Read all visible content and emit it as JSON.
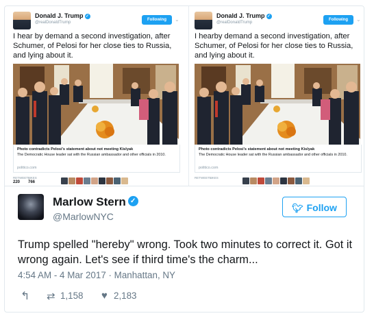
{
  "colors": {
    "accent": "#1da1f2",
    "muted": "#657786",
    "border": "#e1e8ed"
  },
  "embeds": [
    {
      "author_name": "Donald J. Trump",
      "handle": "@realDonaldTrump",
      "follow_label": "Following",
      "text": "I hear by demand a second investigation, after Schumer, of Pelosi for her close ties to Russia, and lying about it.",
      "link_title": "Photo contradicts Pelosi's statement about not meeting Kislyak",
      "link_description": "The Democratic House leader sat with the Russian ambassador and other officials in 2010.",
      "link_site": "politico.com",
      "retweets_label": "RETWEETS",
      "retweets_count": "220",
      "likes_label": "LIKES",
      "likes_count": "766"
    },
    {
      "author_name": "Donald J. Trump",
      "handle": "@realDonaldTrump",
      "follow_label": "Following",
      "text": "I hearby demand a second investigation, after Schumer, of Pelosi for her close ties to Russia, and lying about it.",
      "link_title": "Photo contradicts Pelosi's statement about not meeting Kislyak",
      "link_description": "The Democratic House leader sat with the Russian ambassador and other officials in 2010.",
      "link_site": "politico.com",
      "retweets_label": "RETWEETS",
      "retweets_count": "",
      "likes_label": "LIKES",
      "likes_count": ""
    }
  ],
  "tweet": {
    "author_name": "Marlow Stern",
    "handle": "@MarlowNYC",
    "follow_label": "Follow",
    "text": "Trump spelled \"hereby\" wrong. Took two minutes to correct it. Got it wrong again. Let's see if third time's the charm...",
    "timestamp": "4:54 AM - 4 Mar 2017 · Manhattan, NY",
    "retweets": "1,158",
    "likes": "2,183"
  },
  "icons": {
    "verified": "verified-badge-icon",
    "bird": "twitter-bird-icon",
    "reply": "reply-icon",
    "retweet": "retweet-icon",
    "like": "heart-icon"
  }
}
